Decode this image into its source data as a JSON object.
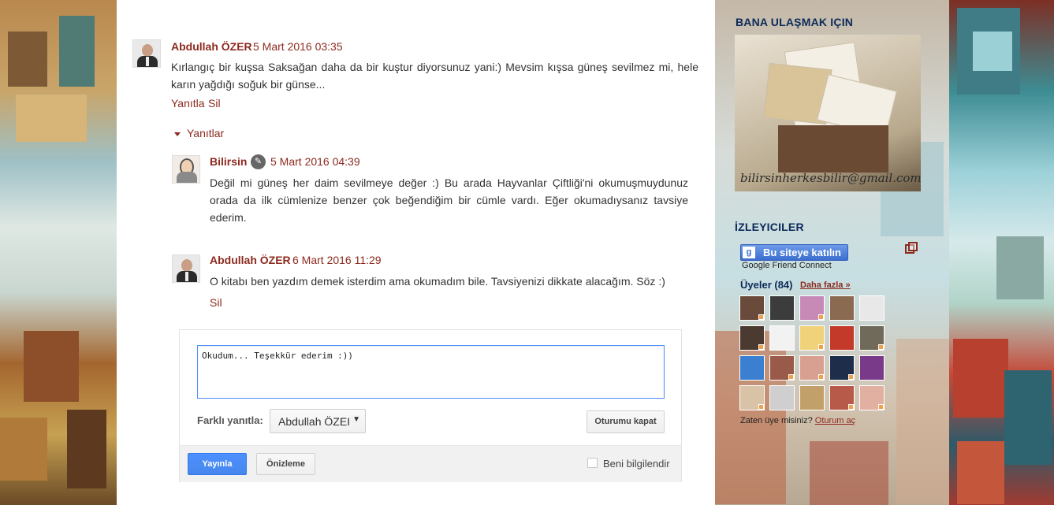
{
  "comments": [
    {
      "author": "Abdullah ÖZER",
      "date": "5 Mart 2016 03:35",
      "text": "Kırlangıç bir kuşsa Saksağan daha da bir kuştur diyorsunuz yani:) Mevsim kışsa güneş sevilmez mi, hele karın yağdığı soğuk bir günse...",
      "reply_label": "Yanıtla",
      "delete_label": "Sil"
    },
    {
      "author": "Bilirsin",
      "date": "5 Mart 2016 04:39",
      "text": "Değil mi güneş her daim sevilmeye değer :) Bu arada Hayvanlar Çiftliği'ni okumuşmuydunuz orada da ilk cümlenize benzer çok beğendiğim bir cümle vardı. Eğer okumadıysanız tavsiye ederim.",
      "icon": "pencil-icon"
    },
    {
      "author": "Abdullah ÖZER",
      "date": "6 Mart 2016 11:29",
      "text": "O kitabı ben yazdım demek isterdim ama okumadım bile. Tavsiyenizi dikkate alacağım. Söz :)",
      "delete_label": "Sil"
    }
  ],
  "replies_toggle": "Yanıtlar",
  "reply_form": {
    "text_value": "Okudum... Teşekkür ederim :))",
    "reply_as_label": "Farklı yanıtla:",
    "reply_as_value": "Abdullah ÖZEI",
    "signout_label": "Oturumu kapat",
    "publish_label": "Yayınla",
    "preview_label": "Önizleme",
    "notify_label": "Beni bilgilendir"
  },
  "sidebar": {
    "contact_title": "BANA ULAŞMAK IÇIN",
    "contact_email": "bilirsinherkesbilir@gmail.com",
    "followers_title": "İZLEYICILER",
    "join_button": "Bu siteye katılın",
    "gfc_label": "Google Friend Connect",
    "members_label": "Üyeler (84)",
    "more_label": "Daha fazla »",
    "already_member": "Zaten üye misiniz?",
    "sign_in": "Oturum aç"
  },
  "colors": {
    "link": "#8c2a1e",
    "widget_title": "#0b2a5a",
    "primary_button": "#4d90fe"
  }
}
